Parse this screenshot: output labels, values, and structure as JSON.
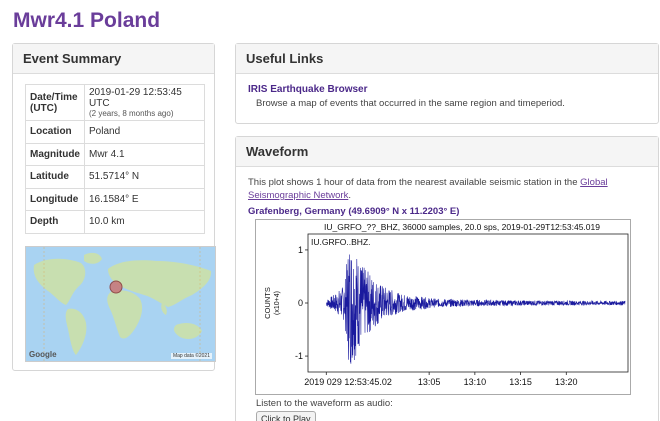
{
  "page": {
    "title": "Mwr4.1 Poland"
  },
  "summary": {
    "heading": "Event Summary",
    "rows": [
      {
        "label": "Date/Time (UTC)",
        "value": "2019-01-29 12:53:45 UTC",
        "sub": "(2 years, 8 months ago)"
      },
      {
        "label": "Location",
        "value": "Poland"
      },
      {
        "label": "Magnitude",
        "value": "Mwr 4.1"
      },
      {
        "label": "Latitude",
        "value": "51.5714° N"
      },
      {
        "label": "Longitude",
        "value": "16.1584° E"
      },
      {
        "label": "Depth",
        "value": "10.0 km"
      }
    ],
    "map": {
      "google": "Google",
      "attribution": "Map data ©2021",
      "ocean_color": "#a9d3f2",
      "land_color": "#c8dfb0",
      "marker_color": "#c97a7a"
    }
  },
  "links": {
    "heading": "Useful Links",
    "items": [
      {
        "title": "IRIS Earthquake Browser",
        "description": "Browse a map of events that occurred in the same region and timeperiod."
      }
    ]
  },
  "waveform": {
    "heading": "Waveform",
    "intro_text": "This plot shows 1 hour of data from the nearest available seismic station in the ",
    "intro_link": "Global Seismographic Network",
    "intro_end": ".",
    "station_name": "Grafenberg, Germany",
    "station_coords": "(49.6909° N x 11.2203° E)",
    "listen_text": "Listen to the waveform as audio:",
    "play_label": "Click to Play",
    "trace_color": "#1a1a9e"
  },
  "chart_data": {
    "type": "line",
    "title": "IU_GRFO_??_BHZ, 36000 samples, 20.0 sps, 2019-01-29T12:53:45.019",
    "trace_label": "IU.GRFO..BHZ.",
    "ylabel": "COUNTS",
    "yunit": "(x10+4)",
    "ylim": [
      -1.3,
      1.3
    ],
    "yticks": [
      1,
      0,
      -1
    ],
    "ytick_labels": [
      "1",
      "0",
      "-1"
    ],
    "xtick_labels": [
      "2019 029 12:53:45.02",
      "13:05",
      "13:10",
      "13:15",
      "13:20"
    ],
    "xticks_min": [
      0,
      11.25,
      16.25,
      21.25,
      26.25
    ],
    "xlim_min": [
      -2,
      33
    ],
    "envelope": {
      "t_min": [
        0,
        1,
        2,
        2.5,
        3,
        4,
        6,
        8,
        12,
        20,
        30
      ],
      "amplitude": [
        0.06,
        0.18,
        0.35,
        1.25,
        1.1,
        0.7,
        0.35,
        0.18,
        0.08,
        0.05,
        0.04
      ]
    }
  }
}
